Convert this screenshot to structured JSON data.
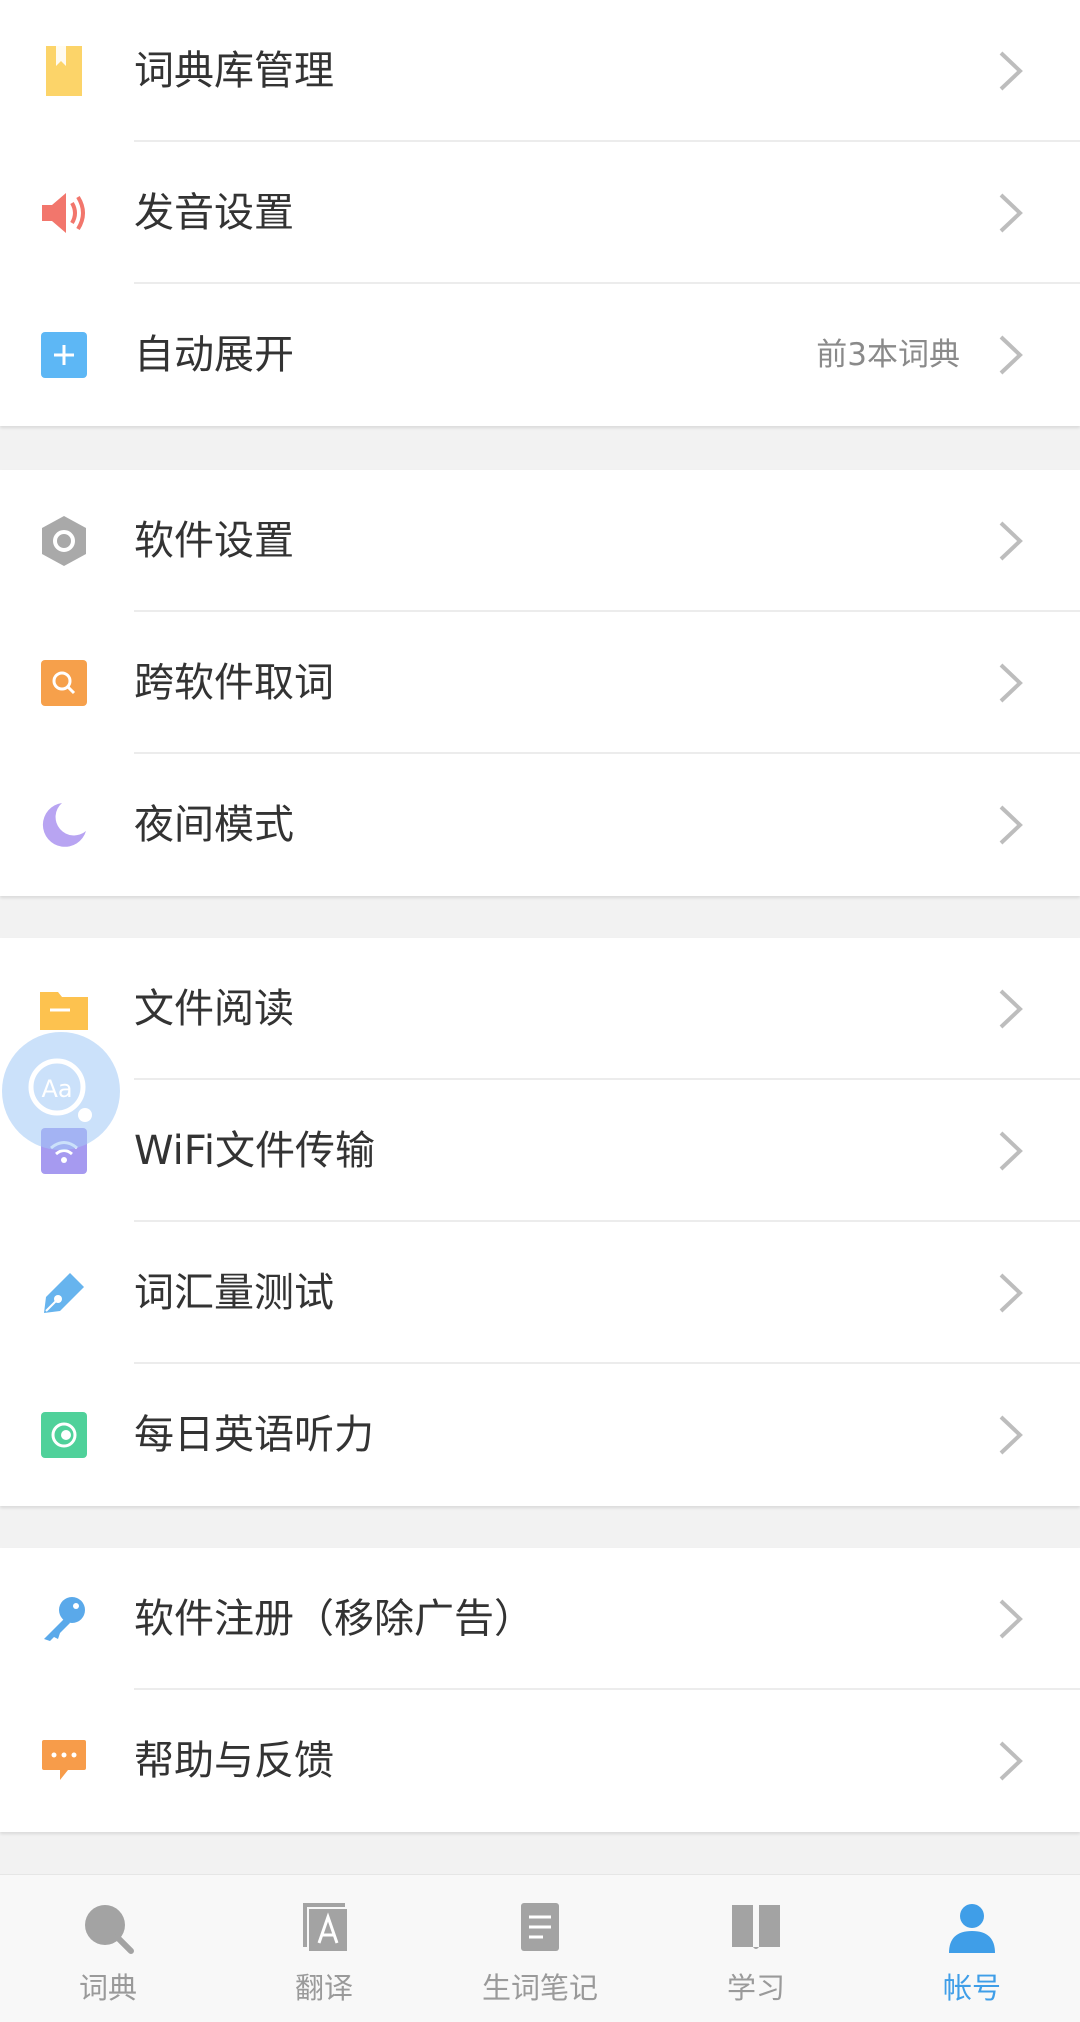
{
  "groups": [
    {
      "items": [
        {
          "label": "词典库管理",
          "icon": "bookmark-icon"
        },
        {
          "label": "发音设置",
          "icon": "speaker-icon"
        },
        {
          "label": "自动展开",
          "icon": "plus-box-icon",
          "value": "前3本词典"
        }
      ]
    },
    {
      "items": [
        {
          "label": "软件设置",
          "icon": "hexagon-gear-icon"
        },
        {
          "label": "跨软件取词",
          "icon": "search-box-icon"
        },
        {
          "label": "夜间模式",
          "icon": "moon-icon"
        }
      ]
    },
    {
      "items": [
        {
          "label": "文件阅读",
          "icon": "folder-icon"
        },
        {
          "label": "WiFi文件传输",
          "icon": "wifi-icon"
        },
        {
          "label": "词汇量测试",
          "icon": "pen-icon"
        },
        {
          "label": "每日英语听力",
          "icon": "radio-icon"
        }
      ]
    },
    {
      "items": [
        {
          "label": "软件注册（移除广告）",
          "icon": "key-icon"
        },
        {
          "label": "帮助与反馈",
          "icon": "chat-icon"
        }
      ]
    }
  ],
  "floating_button": {
    "text": "Aa",
    "icon": "word-lookup-icon"
  },
  "tabbar": {
    "tabs": [
      {
        "label": "词典",
        "icon": "search-icon"
      },
      {
        "label": "翻译",
        "icon": "translate-icon"
      },
      {
        "label": "生词笔记",
        "icon": "note-icon"
      },
      {
        "label": "学习",
        "icon": "book-icon"
      },
      {
        "label": "帐号",
        "icon": "user-icon",
        "active": true
      }
    ]
  },
  "colors": {
    "accent": "#3f9ee8",
    "bookmark": "#fcd469",
    "speaker": "#f2766c",
    "plus": "#5db7f5",
    "hexagon": "#a9a9a9",
    "search": "#f6a04b",
    "moon": "#b8a4f2",
    "folder": "#fdc24f",
    "wifi": "#a69af0",
    "pen": "#67b4ee",
    "radio": "#4fd19a",
    "key": "#5aa9ea",
    "chat": "#f79c4a"
  }
}
